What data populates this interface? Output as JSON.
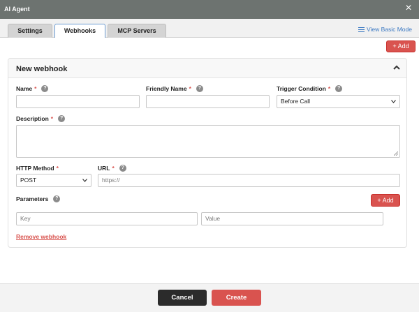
{
  "window": {
    "title": "AI Agent",
    "close_icon": "close-icon"
  },
  "tabs": [
    {
      "label": "Settings",
      "active": false
    },
    {
      "label": "Webhooks",
      "active": true
    },
    {
      "label": "MCP Servers",
      "active": false
    }
  ],
  "view_basic_mode": {
    "label": "View Basic Mode",
    "icon": "list-icon"
  },
  "add_top": {
    "label": "+ Add"
  },
  "webhook": {
    "title": "New webhook",
    "collapse_icon": "chevron-up-icon",
    "name": {
      "label": "Name",
      "required": "*",
      "value": ""
    },
    "friendly_name": {
      "label": "Friendly Name",
      "required": "*",
      "value": ""
    },
    "trigger_condition": {
      "label": "Trigger Condition",
      "required": "*",
      "value": "Before Call"
    },
    "description": {
      "label": "Description",
      "required": "*",
      "value": ""
    },
    "http_method": {
      "label": "HTTP Method",
      "required": "*",
      "value": "POST"
    },
    "url": {
      "label": "URL",
      "required": "*",
      "placeholder": "https://"
    },
    "parameters": {
      "label": "Parameters",
      "add_label": "+ Add",
      "key_placeholder": "Key",
      "value_placeholder": "Value"
    },
    "remove_label": "Remove webhook"
  },
  "footer": {
    "cancel_label": "Cancel",
    "create_label": "Create"
  },
  "colors": {
    "accent_red": "#d9534f",
    "titlebar": "#6d7370",
    "link_blue": "#3a78c2"
  }
}
